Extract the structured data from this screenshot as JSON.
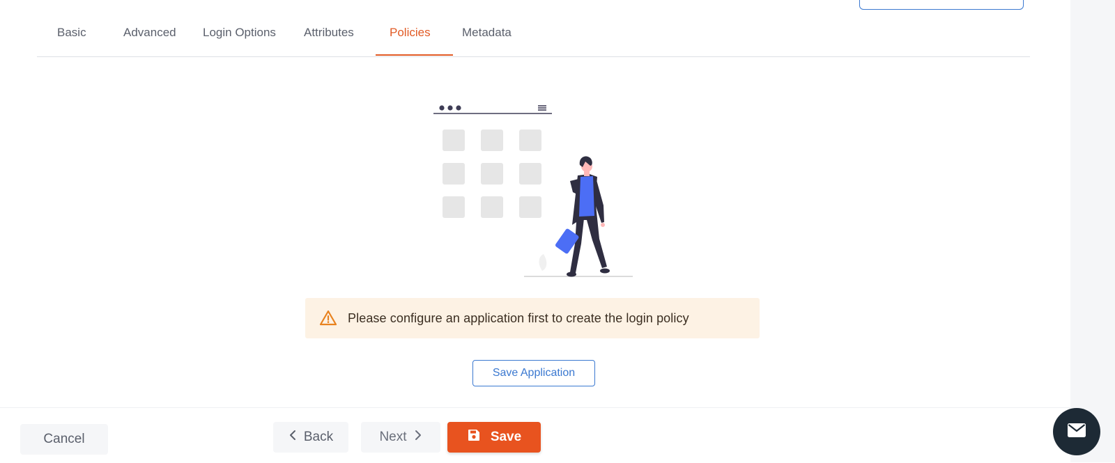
{
  "tabs": [
    {
      "label": "Basic"
    },
    {
      "label": "Advanced"
    },
    {
      "label": "Login Options"
    },
    {
      "label": "Attributes"
    },
    {
      "label": "Policies",
      "active": true
    },
    {
      "label": "Metadata"
    }
  ],
  "alert": {
    "icon": "warning-icon",
    "message": "Please configure an application first to create the login policy"
  },
  "save_application_label": "Save Application",
  "footer": {
    "cancel_label": "Cancel",
    "back_label": "Back",
    "next_label": "Next",
    "save_label": "Save"
  },
  "colors": {
    "accent": "#e15a24",
    "link_blue": "#3a78d0",
    "alert_bg": "#fdf2e4",
    "chat_bg": "#1d2a35"
  }
}
